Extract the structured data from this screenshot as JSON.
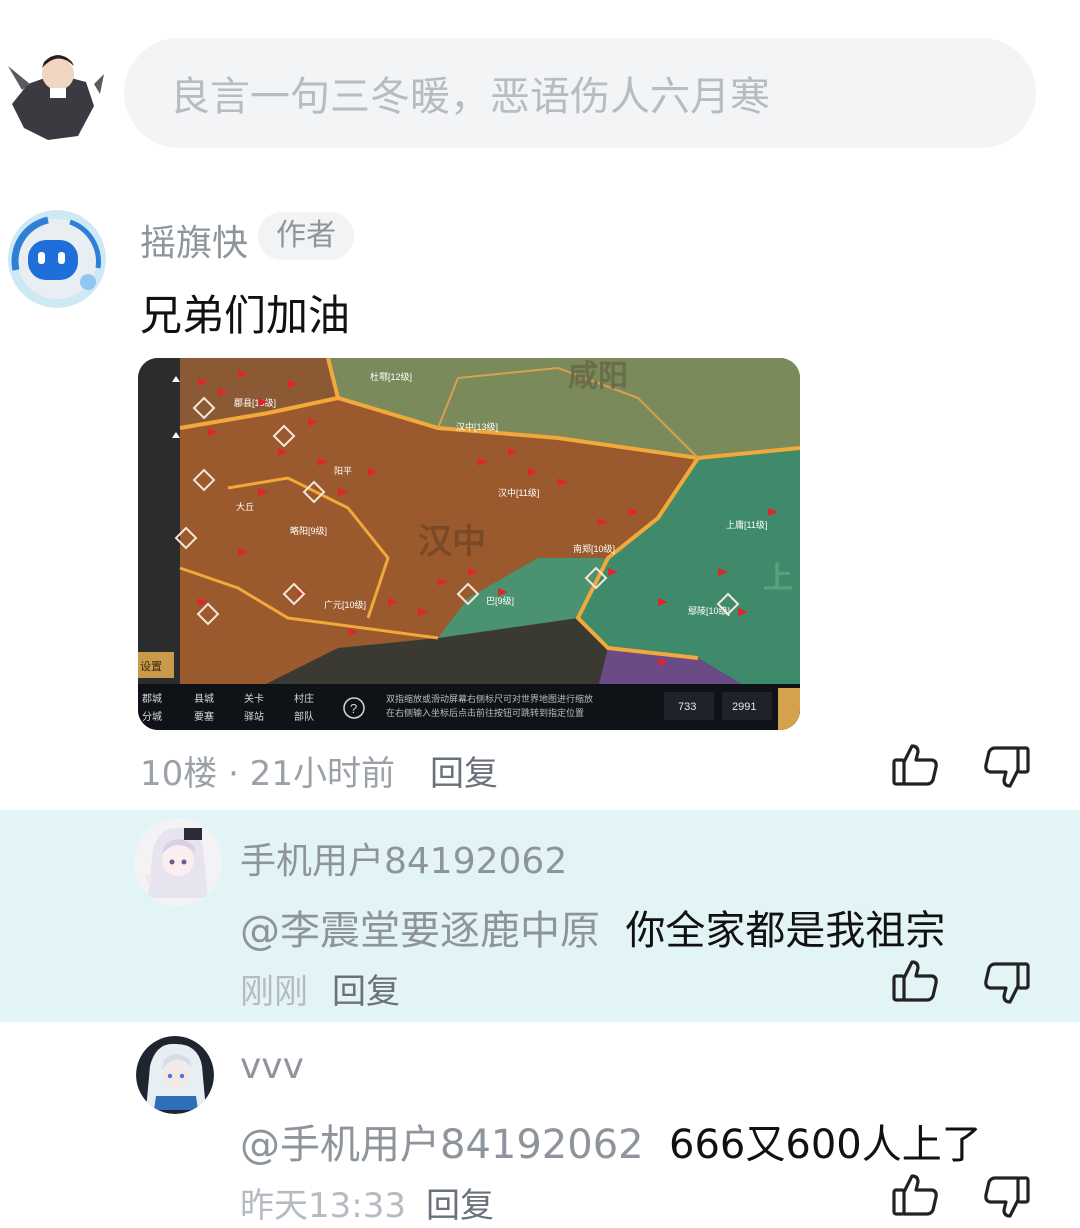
{
  "compose": {
    "placeholder": "良言一句三冬暖，恶语伤人六月寒"
  },
  "main_comment": {
    "author": "摇旗快",
    "badge": "作者",
    "text": "兄弟们加油",
    "floor_time": "10楼 · 21小时前",
    "reply_label": "回复",
    "image": {
      "region_label_main": "汉中",
      "region_label_top": "咸阳",
      "region_label_right": "上",
      "city_labels": [
        "杜鄠[12级]",
        "郿县[10级]",
        "汉中[11级]",
        "汉中[13级]",
        "南郑[10级]",
        "上庸[11级]",
        "略阳[9级]",
        "广元[10级]",
        "鄢陵[10级]",
        "巴[9级]",
        "大丘",
        "阳平"
      ],
      "legend": [
        {
          "icon": "郡城",
          "label": "郡城"
        },
        {
          "icon": "县城",
          "label": "县城"
        },
        {
          "icon": "关卡",
          "label": "关卡"
        },
        {
          "icon": "村庄",
          "label": "村庄"
        },
        {
          "icon": "分城",
          "label": "分城"
        },
        {
          "icon": "要塞",
          "label": "要塞"
        },
        {
          "icon": "驿站",
          "label": "驿站"
        },
        {
          "icon": "部队",
          "label": "部队"
        }
      ],
      "hint_line1": "双指缩放或滑动屏幕右侧标尺可对世界地图进行缩放",
      "hint_line2": "在右侧输入坐标后点击前往按钮可跳转到指定位置",
      "coord_x": "733",
      "coord_y": "2991",
      "side_tab": "设置"
    }
  },
  "replies": [
    {
      "name": "手机用户84192062",
      "mention": "@李震堂要逐鹿中原",
      "text": "你全家都是我祖宗",
      "time": "刚刚",
      "reply_label": "回复"
    },
    {
      "name": "vvv",
      "mention": "@手机用户84192062",
      "text": "666又600人上了",
      "time": "昨天13:33",
      "reply_label": "回复"
    }
  ],
  "icons": {
    "like": "thumbs-up-icon",
    "dislike": "thumbs-down-icon"
  }
}
